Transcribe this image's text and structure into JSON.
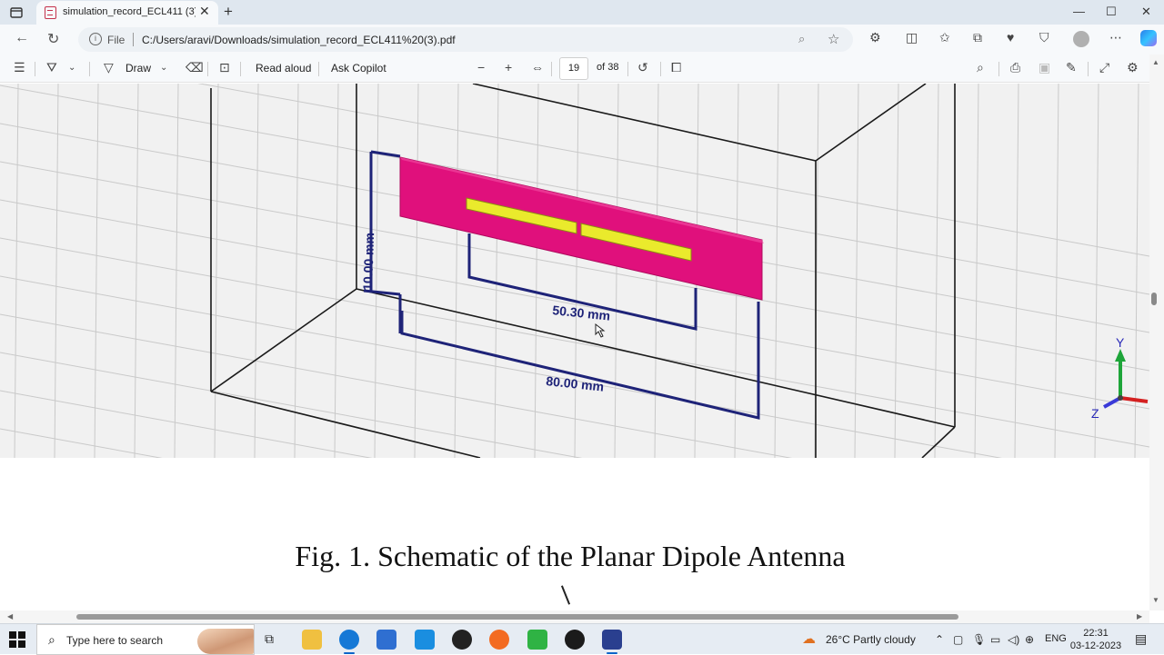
{
  "browser": {
    "tab_title": "simulation_record_ECL411 (3).pdf",
    "new_tab_symbol": "+",
    "address_scheme": "File",
    "address_url": "C:/Users/aravi/Downloads/simulation_record_ECL411%20(3).pdf"
  },
  "pdf_toolbar": {
    "draw_label": "Draw",
    "read_aloud_label": "Read aloud",
    "ask_copilot_label": "Ask Copilot",
    "current_page": "19",
    "total_pages_label": "of 38"
  },
  "figure": {
    "dim_height": "10.00 mm",
    "dim_dipole": "50.30 mm",
    "dim_width": "80.00 mm",
    "axis_y": "Y",
    "axis_z": "Z",
    "colors": {
      "substrate": "#e0107c",
      "dipole": "#eaea2c",
      "dimension_lines": "#1e2378",
      "grid": "#c8c8c8"
    }
  },
  "document": {
    "caption": "Fig. 1. Schematic of the Planar Dipole Antenna"
  },
  "taskbar": {
    "search_placeholder": "Type here to search",
    "weather": "26°C  Partly cloudy",
    "language": "ENG",
    "time": "22:31",
    "date": "03-12-2023"
  }
}
